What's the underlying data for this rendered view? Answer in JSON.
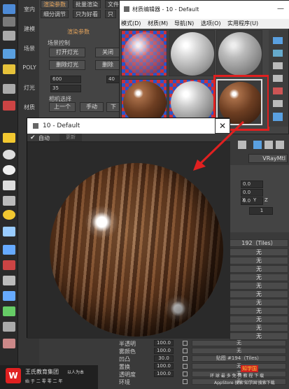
{
  "left_nav": {
    "items": [
      "室内",
      "建模",
      "场景",
      "POLY",
      "灯光",
      "材质"
    ]
  },
  "render_panel": {
    "tabs": [
      "渲染参数",
      "批量渲染",
      "文件"
    ],
    "tabs2": [
      "细分调节",
      "只为好看",
      "只"
    ],
    "title": "渲染参数",
    "group": "场景控制",
    "btn_open_light": "打开灯光",
    "btn_close_light": "关闭",
    "btn_delete_light": "删除灯光",
    "btn_delete2": "删除",
    "val_600": "600",
    "val_35": "35",
    "val_40": "40",
    "camera_label": "相机选择",
    "btn_prev": "上一个",
    "btn_manual": "手动",
    "btn_next": "下"
  },
  "mat_editor": {
    "title": "材质编辑器 - 10 - Default",
    "menu": [
      "模式(D)",
      "材质(M)",
      "导航(N)",
      "选项(O)",
      "实用程序(U)"
    ]
  },
  "preview": {
    "title": "10 - Default",
    "auto_label": "自动",
    "update_label": "更新"
  },
  "param_panel": {
    "vray_label": "VRayMtl",
    "spinner_values": [
      "0.0",
      "0.0",
      "0.0"
    ],
    "axis": [
      "X",
      "Y",
      "Z"
    ],
    "val_1": "1",
    "tiles_192": "192（Tiles）",
    "no_map": "无",
    "no_rows_count": 10
  },
  "map_table": {
    "rows": [
      {
        "label": "半透明",
        "value": "100.0",
        "map": "无"
      },
      {
        "label": "雾颜色",
        "value": "100.0",
        "map": "无"
      },
      {
        "label": "凹凸",
        "value": "30.0",
        "map": "贴图 #194（Tiles）"
      },
      {
        "label": "置换",
        "value": "100.0",
        "map": "无"
      },
      {
        "label": "透明度",
        "value": "100.0",
        "map": "无"
      },
      {
        "label": "环境",
        "value": "",
        "map": "无"
      }
    ]
  },
  "brand": {
    "name": "王氏教育集团",
    "slogan": "以人为本",
    "sub": "始 于 二 零 零 二 年"
  },
  "watermark": {
    "line1": "环 球 最 多 免 费 教 程 下 载",
    "line2": "AppStore 搜索'知学国'搜索下载",
    "logo": "知学国"
  },
  "colors": {
    "highlight_red": "#e02020",
    "accent_orange": "#e2a25b"
  }
}
